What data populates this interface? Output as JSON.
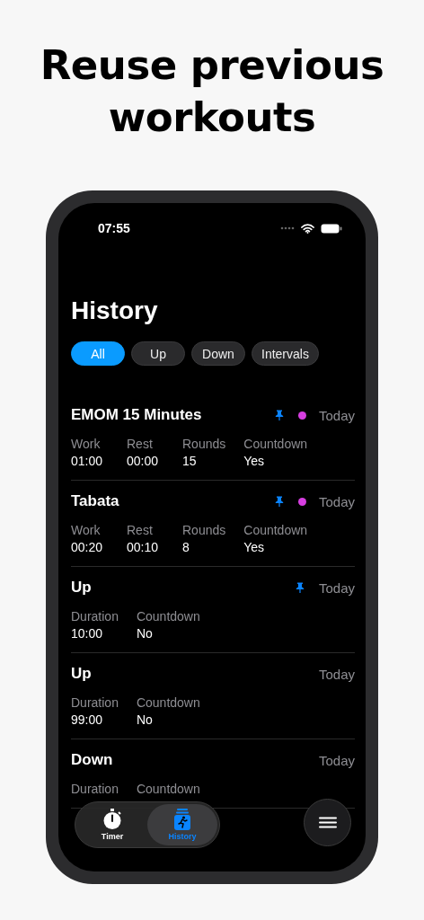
{
  "headline": "Reuse previous workouts",
  "status_bar": {
    "time": "07:55"
  },
  "title": "History",
  "filters": [
    {
      "label": "All",
      "selected": true
    },
    {
      "label": "Up",
      "selected": false
    },
    {
      "label": "Down",
      "selected": false
    },
    {
      "label": "Intervals",
      "selected": false
    }
  ],
  "workouts": [
    {
      "name": "EMOM 15 Minutes",
      "pinned": true,
      "color": "#d63ee0",
      "date": "Today",
      "fields": [
        {
          "label": "Work",
          "value": "01:00"
        },
        {
          "label": "Rest",
          "value": "00:00"
        },
        {
          "label": "Rounds",
          "value": "15"
        },
        {
          "label": "Countdown",
          "value": "Yes"
        }
      ]
    },
    {
      "name": "Tabata",
      "pinned": true,
      "color": "#d63ee0",
      "date": "Today",
      "fields": [
        {
          "label": "Work",
          "value": "00:20"
        },
        {
          "label": "Rest",
          "value": "00:10"
        },
        {
          "label": "Rounds",
          "value": "8"
        },
        {
          "label": "Countdown",
          "value": "Yes"
        }
      ]
    },
    {
      "name": "Up",
      "pinned": true,
      "date": "Today",
      "fields": [
        {
          "label": "Duration",
          "value": "10:00"
        },
        {
          "label": "Countdown",
          "value": "No"
        }
      ]
    },
    {
      "name": "Up",
      "pinned": false,
      "date": "Today",
      "fields": [
        {
          "label": "Duration",
          "value": "99:00"
        },
        {
          "label": "Countdown",
          "value": "No"
        }
      ]
    },
    {
      "name": "Down",
      "pinned": false,
      "date": "Today",
      "fields": [
        {
          "label": "Duration"
        },
        {
          "label": "Countdown"
        }
      ]
    }
  ],
  "tab_bar": [
    {
      "label": "Timer",
      "kind": "timer",
      "selected": false
    },
    {
      "label": "History",
      "kind": "history",
      "selected": true
    }
  ]
}
